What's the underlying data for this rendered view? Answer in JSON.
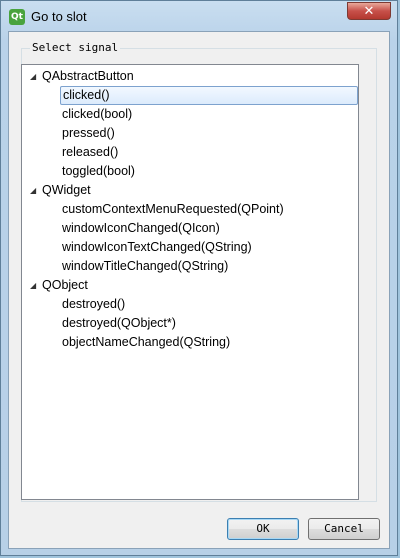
{
  "window": {
    "title": "Go to slot",
    "app_icon_text": "Qt",
    "close_glyph": "✕"
  },
  "group": {
    "title": "Select signal"
  },
  "tree": [
    {
      "label": "QAbstractButton",
      "level": 0,
      "expanded": true
    },
    {
      "label": "clicked()",
      "level": 1,
      "selected": true
    },
    {
      "label": "clicked(bool)",
      "level": 1
    },
    {
      "label": "pressed()",
      "level": 1
    },
    {
      "label": "released()",
      "level": 1
    },
    {
      "label": "toggled(bool)",
      "level": 1
    },
    {
      "label": "QWidget",
      "level": 0,
      "expanded": true
    },
    {
      "label": "customContextMenuRequested(QPoint)",
      "level": 1
    },
    {
      "label": "windowIconChanged(QIcon)",
      "level": 1
    },
    {
      "label": "windowIconTextChanged(QString)",
      "level": 1
    },
    {
      "label": "windowTitleChanged(QString)",
      "level": 1
    },
    {
      "label": "QObject",
      "level": 0,
      "expanded": true
    },
    {
      "label": "destroyed()",
      "level": 1
    },
    {
      "label": "destroyed(QObject*)",
      "level": 1
    },
    {
      "label": "objectNameChanged(QString)",
      "level": 1
    }
  ],
  "buttons": {
    "ok": "OK",
    "cancel": "Cancel"
  },
  "icons": {
    "expanded_arrow": "◢",
    "window_icon": "qt-icon",
    "close_icon": "close-icon"
  },
  "colors": {
    "selection_border": "#7da2ce",
    "close_button": "#c7504a"
  }
}
